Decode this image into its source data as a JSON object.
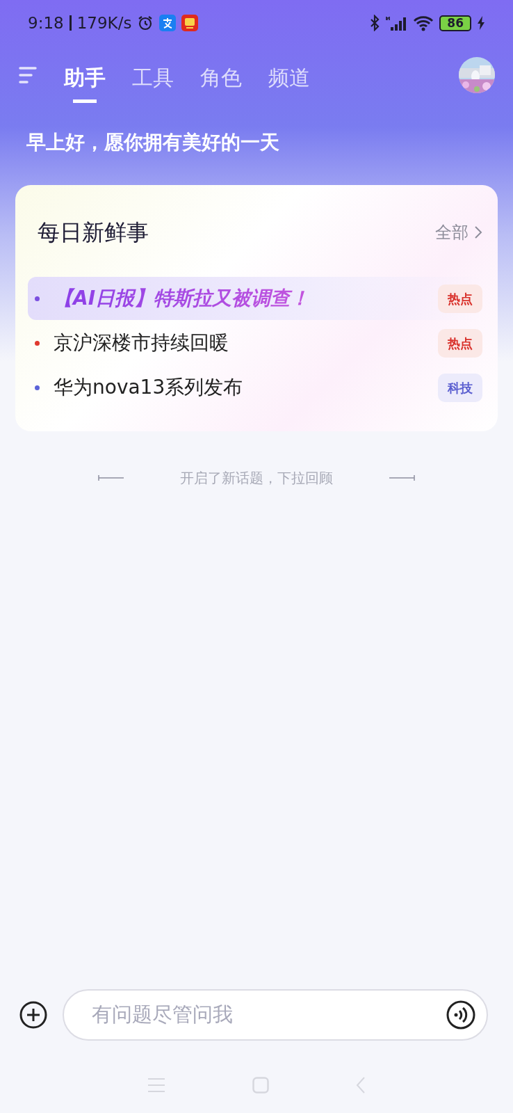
{
  "status_bar": {
    "time": "9:18",
    "speed": "179K/s",
    "battery": "86"
  },
  "tabs": [
    {
      "label": "助手",
      "selected": true
    },
    {
      "label": "工具",
      "selected": false
    },
    {
      "label": "角色",
      "selected": false
    },
    {
      "label": "频道",
      "selected": false
    }
  ],
  "greeting": "早上好，愿你拥有美好的一天",
  "news": {
    "title": "每日新鲜事",
    "more": "全部",
    "items": [
      {
        "title": "【AI日报】特斯拉又被调查！",
        "tag": "热点",
        "kind": "hot",
        "color": "#7b4fe0",
        "selected": true
      },
      {
        "title": "京沪深楼市持续回暖",
        "tag": "热点",
        "kind": "hot",
        "color": "#e0392f",
        "selected": false
      },
      {
        "title": "华为nova13系列发布",
        "tag": "科技",
        "kind": "tech",
        "color": "#5b63d8",
        "selected": false
      }
    ]
  },
  "divider_text": "开启了新话题，下拉回顾",
  "input": {
    "placeholder": "有问题尽管问我"
  }
}
